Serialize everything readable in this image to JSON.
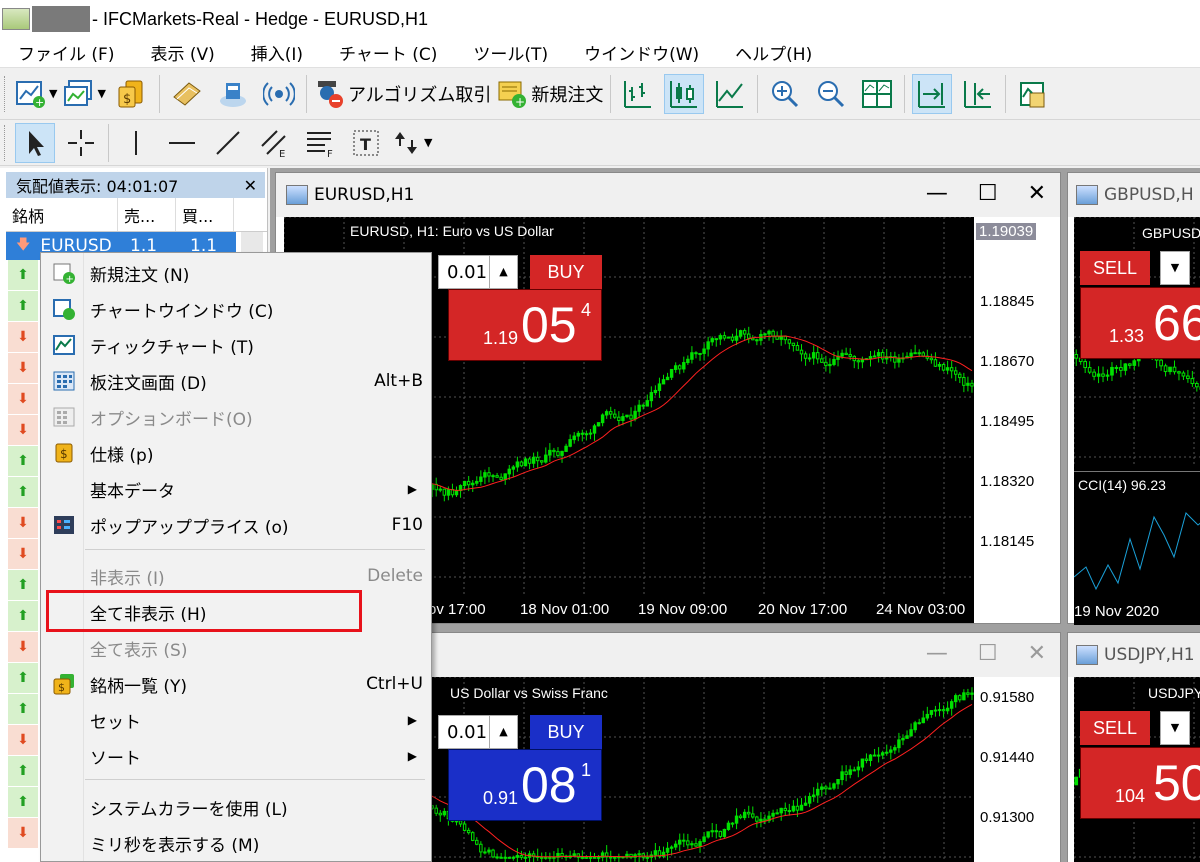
{
  "window": {
    "title": "- IFCMarkets-Real - Hedge - EURUSD,H1"
  },
  "menubar": [
    "ファイル (F)",
    "表示 (V)",
    "挿入(I)",
    "チャート (C)",
    "ツール(T)",
    "ウインドウ(W)",
    "ヘルプ(H)"
  ],
  "toolbar": {
    "algo_trading": "アルゴリズム取引",
    "new_order": "新規注文"
  },
  "market_watch": {
    "header": "気配値表示: 04:01:07",
    "col_symbol": "銘柄",
    "col_bid": "売...",
    "col_ask": "買...",
    "selected_symbol": "EURUSD",
    "selected_bid": "1.1",
    "selected_ask": "1.1"
  },
  "charts": {
    "eurusd": {
      "window_title": "EURUSD,H1",
      "plot_title": "EURUSD, H1:  Euro vs US Dollar",
      "lot": "0.01",
      "buy": "BUY",
      "buy_pre": "1.19",
      "buy_big": "05",
      "buy_sup": "4",
      "yticks": [
        "1.19039",
        "1.18845",
        "1.18670",
        "1.18495",
        "1.18320",
        "1.18145"
      ],
      "xticks": [
        "ov 17:00",
        "18 Nov 01:00",
        "19 Nov 09:00",
        "20 Nov 17:00",
        "24 Nov 03:00"
      ]
    },
    "gbpusd": {
      "window_title": "GBPUSD,H",
      "plot_title": "GBPUSD",
      "sell": "SELL",
      "sell_pre": "1.33",
      "sell_big": "66",
      "indicator": "CCI(14) 96.23",
      "xtick": "19 Nov 2020"
    },
    "usdchf": {
      "plot_title": "US Dollar vs Swiss Franc",
      "lot": "0.01",
      "buy": "BUY",
      "buy_pre": "0.91",
      "buy_big": "08",
      "buy_sup": "1",
      "yticks": [
        "0.91580",
        "0.91440",
        "0.91300"
      ]
    },
    "usdjpy": {
      "window_title": "USDJPY,H1",
      "plot_title": "USDJPY,",
      "sell": "SELL",
      "sell_pre": "104",
      "sell_big": "50"
    }
  },
  "context_menu": {
    "items": [
      {
        "label": "新規注文 (N)",
        "shortcut": "",
        "disabled": false
      },
      {
        "label": "チャートウインドウ (C)",
        "shortcut": "",
        "disabled": false
      },
      {
        "label": "ティックチャート (T)",
        "shortcut": "",
        "disabled": false
      },
      {
        "label": "板注文画面 (D)",
        "shortcut": "Alt+B",
        "disabled": false
      },
      {
        "label": "オプションボード(O)",
        "shortcut": "",
        "disabled": true
      },
      {
        "label": "仕様 (p)",
        "shortcut": "",
        "disabled": false
      },
      {
        "label": "基本データ",
        "shortcut": "",
        "disabled": false
      },
      {
        "label": "ポップアッププライス (o)",
        "shortcut": "F10",
        "disabled": false
      },
      {
        "label": "非表示 (I)",
        "shortcut": "Delete",
        "disabled": true
      },
      {
        "label": "全て非表示 (H)",
        "shortcut": "",
        "disabled": false
      },
      {
        "label": "全て表示 (S)",
        "shortcut": "",
        "disabled": true
      },
      {
        "label": "銘柄一覧 (Y)",
        "shortcut": "Ctrl+U",
        "disabled": false
      },
      {
        "label": "セット",
        "shortcut": "",
        "disabled": false
      },
      {
        "label": "ソート",
        "shortcut": "",
        "disabled": false
      },
      {
        "label": "システムカラーを使用 (L)",
        "shortcut": "",
        "disabled": false
      },
      {
        "label": "ミリ秒を表示する (M)",
        "shortcut": "",
        "disabled": false
      }
    ]
  },
  "colors": {
    "highlight_box": "#e8121b",
    "sell": "#d42626",
    "buy_blue": "#1a2fc8",
    "candle": "#00ff00",
    "ma": "#ff2020"
  }
}
